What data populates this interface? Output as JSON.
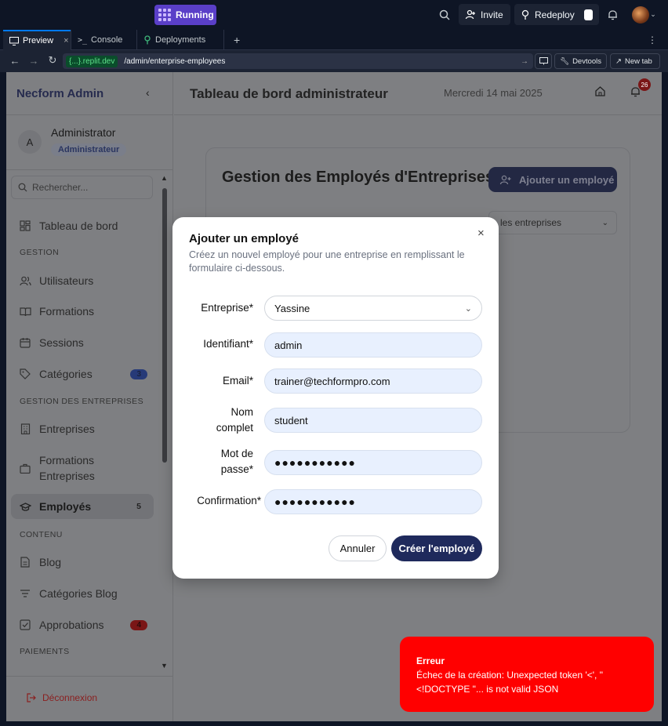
{
  "topbar": {
    "run_label": "Running",
    "invite_label": "Invite",
    "redeploy_label": "Redeploy"
  },
  "tabs": [
    {
      "label": "Preview",
      "close": "×"
    },
    {
      "label": "Console"
    },
    {
      "label": "Deployments"
    }
  ],
  "new_tab_symbol": "+",
  "urlbar": {
    "host": "{...}.replit.dev",
    "path": "/admin/enterprise-employees",
    "devtools_label": "Devtools",
    "newtab_label": "New tab"
  },
  "sidebar": {
    "brand": "Necform Admin",
    "user_initial": "A",
    "user_name": "Administrator",
    "user_role": "Administrateur",
    "search_placeholder": "Rechercher...",
    "dashboard": "Tableau de bord",
    "section_gestion": "GESTION",
    "users": "Utilisateurs",
    "trainings": "Formations",
    "sessions": "Sessions",
    "categories": "Catégories",
    "categories_count": "3",
    "section_enterprises": "GESTION DES ENTREPRISES",
    "enterprises": "Entreprises",
    "enterprise_trainings_1": "Formations",
    "enterprise_trainings_2": "Entreprises",
    "employees": "Employés",
    "employees_count": "5",
    "section_content": "CONTENU",
    "blog": "Blog",
    "blog_categories": "Catégories Blog",
    "approvals": "Approbations",
    "approvals_count": "4",
    "section_payments": "PAIEMENTS",
    "logout": "Déconnexion"
  },
  "header": {
    "title": "Tableau de bord administrateur",
    "date": "Mercredi 14 mai 2025",
    "notifications": "26"
  },
  "page": {
    "title": "Gestion des Employés d'Entreprises",
    "add_button": "Ajouter un employé",
    "filter_value": "les entreprises"
  },
  "modal": {
    "title": "Ajouter un employé",
    "subtitle": "Créez un nouvel employé pour une entreprise en remplissant le formulaire ci-dessous.",
    "labels": {
      "enterprise": "Entreprise*",
      "identifier": "Identifiant*",
      "email": "Email*",
      "fullname_1": "Nom",
      "fullname_2": "complet",
      "password_1": "Mot de",
      "password_2": "passe*",
      "confirmation": "Confirmation*"
    },
    "values": {
      "enterprise": "Yassine",
      "identifier": "admin",
      "email": "trainer@techformpro.com",
      "fullname": "student",
      "password": "●●●●●●●●●●●",
      "confirmation": "●●●●●●●●●●●"
    },
    "cancel": "Annuler",
    "submit": "Créer l'employé"
  },
  "toast": {
    "title": "Erreur",
    "message": "Échec de la création: Unexpected token '<', \"<!DOCTYPE \"... is not valid JSON"
  },
  "colors": {
    "accent": "#5a3fc8",
    "submit": "#1f2a5c",
    "error": "#ff0000"
  }
}
